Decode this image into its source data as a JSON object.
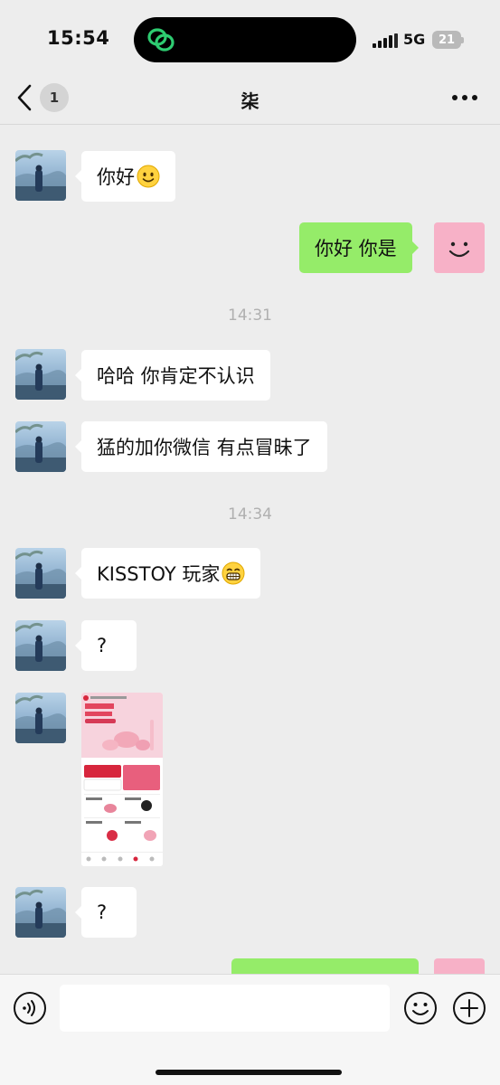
{
  "status_bar": {
    "time": "15:54",
    "network": "5G",
    "battery": "21"
  },
  "nav": {
    "unread_count": "1",
    "title": "柒"
  },
  "messages": [
    {
      "from": "contact",
      "text": "你好",
      "emoji": "smile-emoji"
    },
    {
      "from": "me",
      "text": "你好 你是"
    },
    {
      "timestamp": "14:31"
    },
    {
      "from": "contact",
      "text": "哈哈 你肯定不认识"
    },
    {
      "from": "contact",
      "text": "猛的加你微信 有点冒昧了"
    },
    {
      "timestamp": "14:34"
    },
    {
      "from": "contact",
      "text": "KISSTOY 玩家",
      "emoji": "grin-emoji"
    },
    {
      "from": "contact",
      "text": "?"
    },
    {
      "from": "contact",
      "image": "app-screenshot-image"
    },
    {
      "from": "contact",
      "text": "?"
    }
  ],
  "input_bar": {
    "placeholder": ""
  },
  "colors": {
    "background": "#ededed",
    "incoming_bubble": "#ffffff",
    "outgoing_bubble": "#95ec69",
    "timestamp_text": "#b0b0b0"
  }
}
